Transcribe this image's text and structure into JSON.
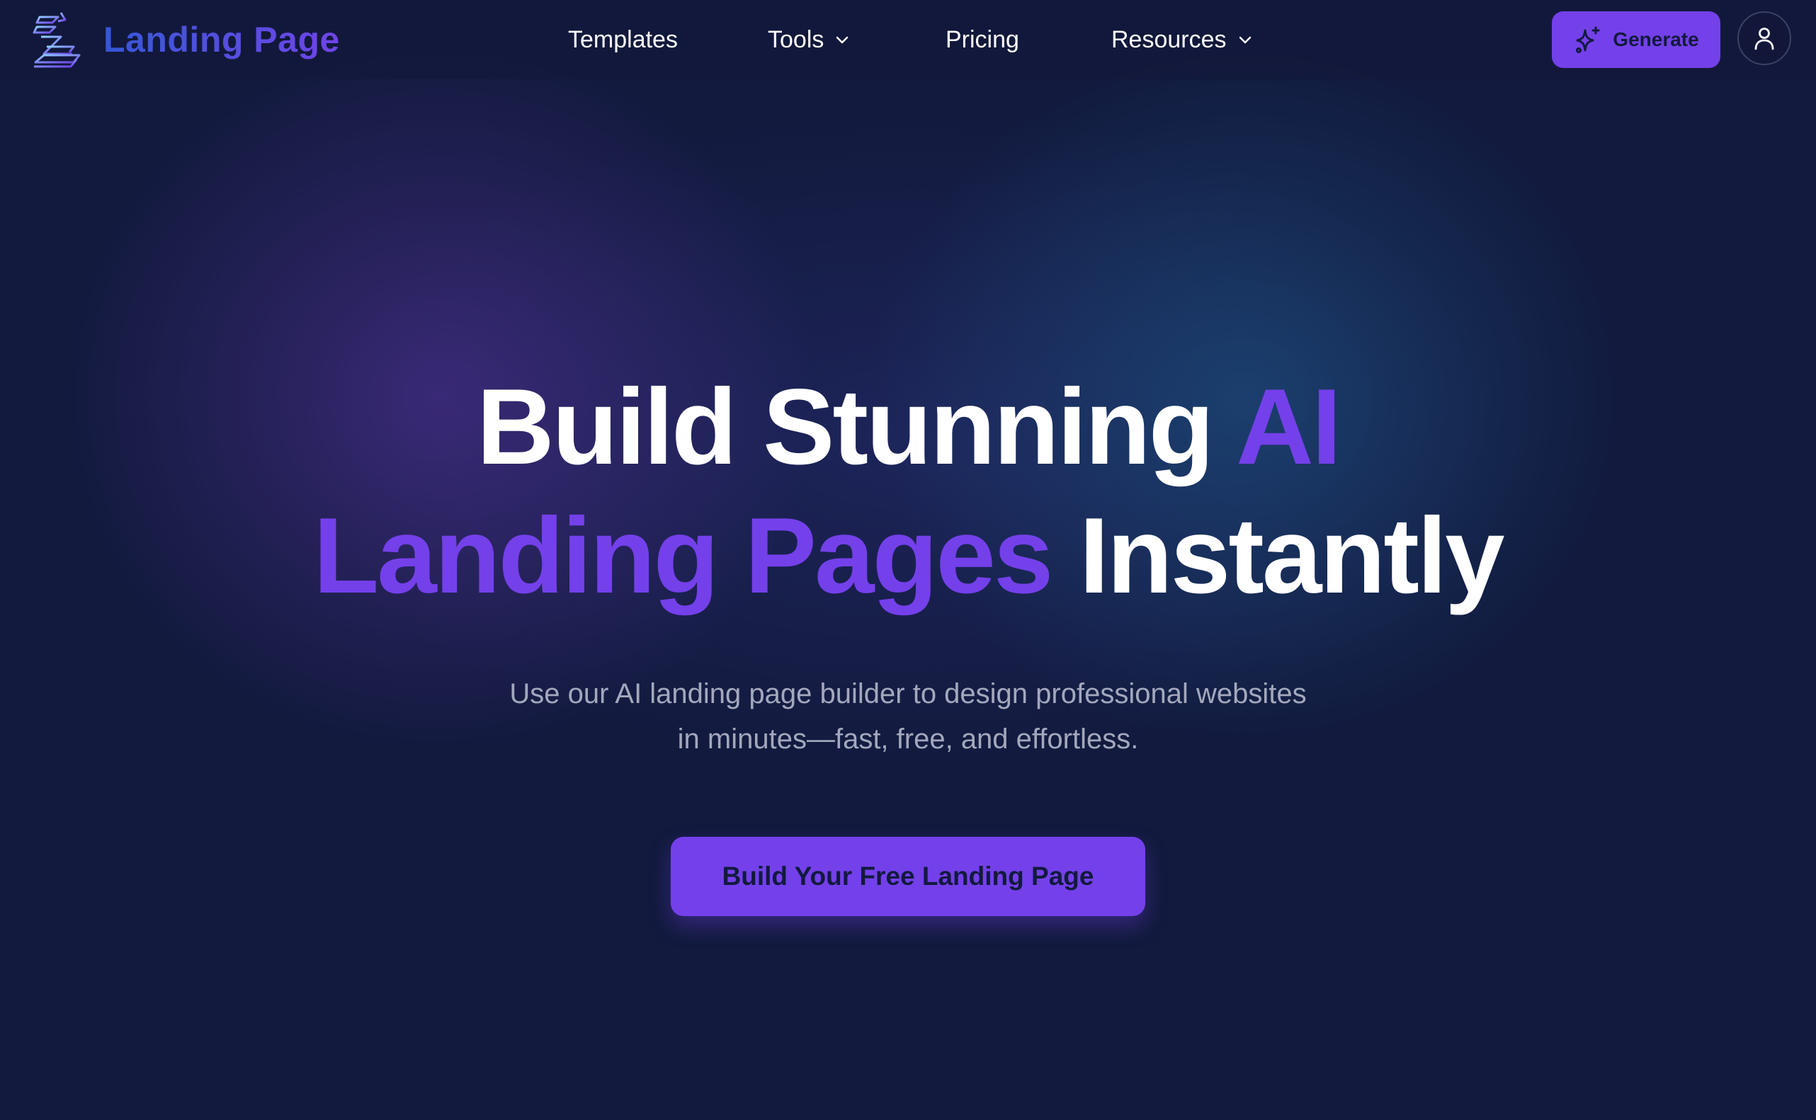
{
  "brand": {
    "name": "Landing Page",
    "logo_icon": "stacked-layers-logo-icon"
  },
  "nav": {
    "items": [
      {
        "label": "Templates",
        "has_dropdown": false
      },
      {
        "label": "Tools",
        "has_dropdown": true
      },
      {
        "label": "Pricing",
        "has_dropdown": false
      },
      {
        "label": "Resources",
        "has_dropdown": true
      }
    ],
    "generate_label": "Generate",
    "generate_icon": "sparkle-icon",
    "account_icon": "user-icon"
  },
  "hero": {
    "headline_part1": "Build Stunning ",
    "headline_accent1": "AI",
    "headline_accent2": "Landing Pages",
    "headline_part2": " Instantly",
    "subtitle_line1": "Use our AI landing page builder to design professional websites",
    "subtitle_line2": "in minutes—fast, free, and effortless.",
    "cta_label": "Build Your Free Landing Page"
  },
  "colors": {
    "background": "#121a3e",
    "accent": "#7440ea",
    "brand_text": "#3557d8",
    "subtitle_text": "#a3a8bd",
    "button_text": "#121a3e"
  }
}
